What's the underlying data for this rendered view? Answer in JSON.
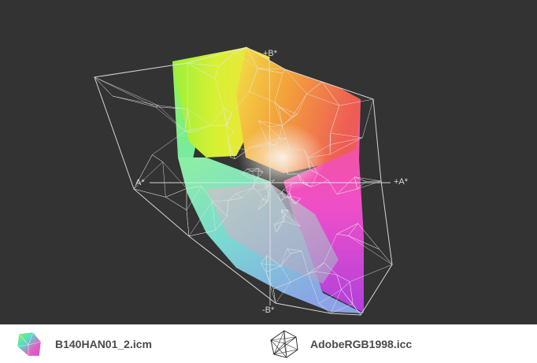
{
  "axes": {
    "plus_b": "+B*",
    "minus_b": "-B*",
    "plus_a": "+A*",
    "minus_a": "A*"
  },
  "legend": [
    {
      "label": "B140HAN01_2.icm",
      "icon": "color-gamut-icon"
    },
    {
      "label": "AdobeRGB1998.icc",
      "icon": "wireframe-gamut-icon"
    }
  ],
  "colors": {
    "background": "#333333",
    "wireframe": "#e6e6e6",
    "legend_text": "#4a4a4a"
  }
}
